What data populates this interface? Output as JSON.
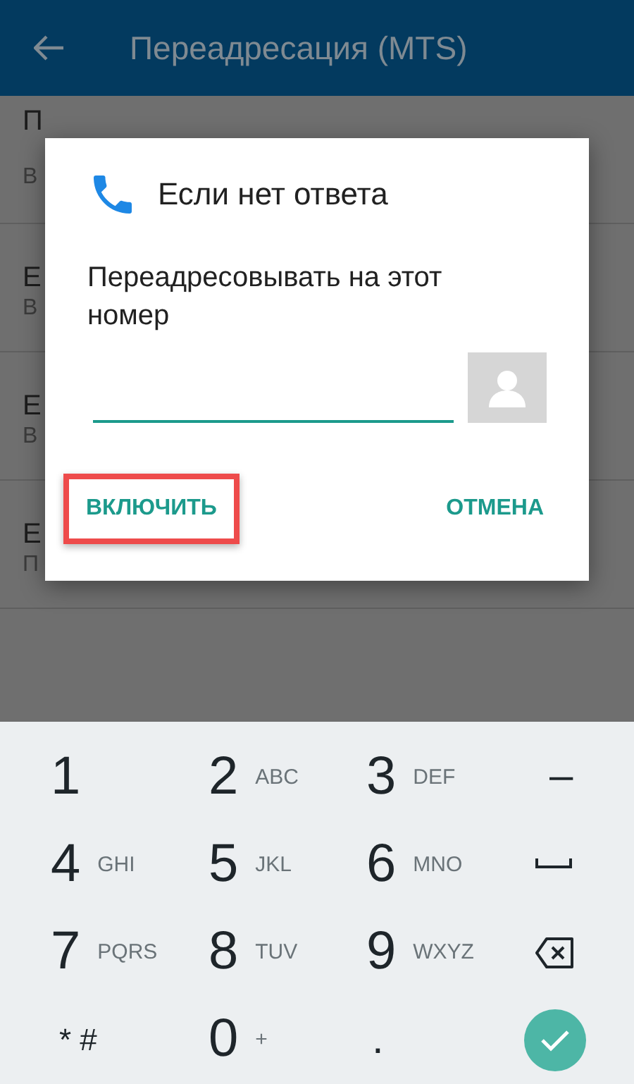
{
  "app_bar": {
    "title": "Переадресация (MTS)"
  },
  "list": [
    {
      "title": "П",
      "subtitle": "В"
    },
    {
      "title": "Е",
      "subtitle": "В"
    },
    {
      "title": "Е",
      "subtitle": "В"
    },
    {
      "title": "Е",
      "subtitle": "П"
    }
  ],
  "dialog": {
    "title": "Если нет ответа",
    "label": "Переадресовывать на этот номер",
    "buttons": [
      {
        "label": "ВКЛЮЧИТЬ",
        "highlighted": true
      },
      {
        "label": "ОТМЕНА",
        "highlighted": false
      }
    ]
  },
  "keypad": [
    {
      "kind": "digit",
      "main": "1"
    },
    {
      "kind": "digit",
      "main": "2",
      "sub": "ABC"
    },
    {
      "kind": "digit",
      "main": "3",
      "sub": "DEF"
    },
    {
      "kind": "symbol",
      "main": "–"
    },
    {
      "kind": "digit",
      "main": "4",
      "sub": "GHI"
    },
    {
      "kind": "digit",
      "main": "5",
      "sub": "JKL"
    },
    {
      "kind": "digit",
      "main": "6",
      "sub": "MNO"
    },
    {
      "kind": "space"
    },
    {
      "kind": "digit",
      "main": "7",
      "sub": "PQRS"
    },
    {
      "kind": "digit",
      "main": "8",
      "sub": "TUV"
    },
    {
      "kind": "digit",
      "main": "9",
      "sub": "WXYZ"
    },
    {
      "kind": "backspace"
    },
    {
      "kind": "small",
      "main": "* #"
    },
    {
      "kind": "digit",
      "main": "0",
      "sub": "+"
    },
    {
      "kind": "symbol",
      "main": "."
    },
    {
      "kind": "done"
    }
  ]
}
